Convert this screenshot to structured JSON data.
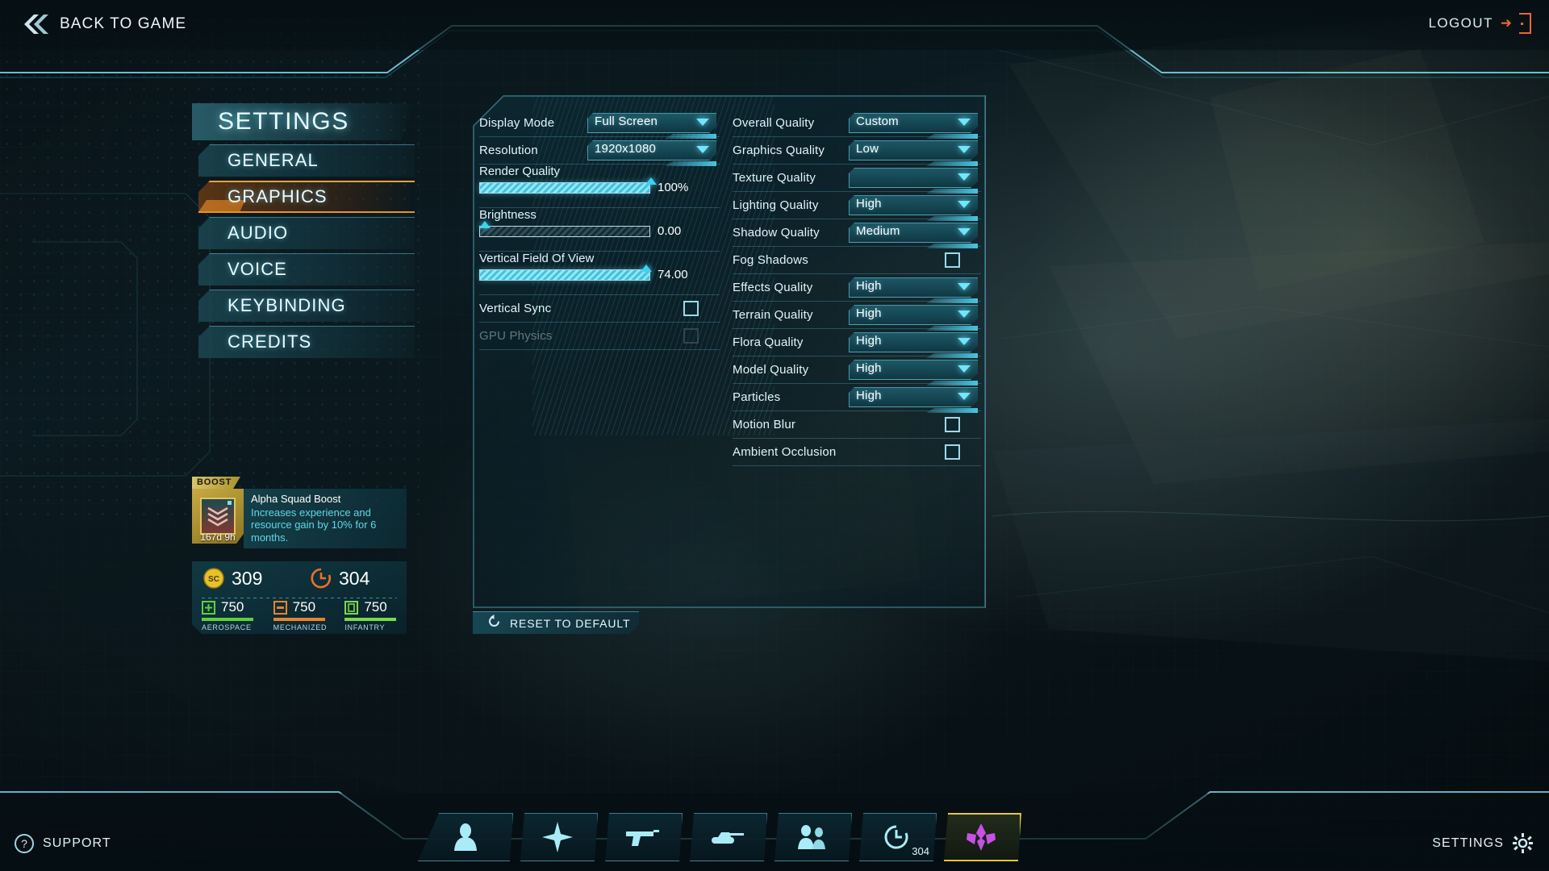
{
  "topbar": {
    "back_label": "BACK TO GAME",
    "back_icon": "double-chevron-left-icon",
    "logout_label": "LOGOUT",
    "logout_icon": "logout-door-icon"
  },
  "nav": {
    "title": "SETTINGS",
    "items": [
      {
        "label": "GENERAL",
        "active": false
      },
      {
        "label": "GRAPHICS",
        "active": true
      },
      {
        "label": "AUDIO",
        "active": false
      },
      {
        "label": "VOICE",
        "active": false
      },
      {
        "label": "KEYBINDING",
        "active": false
      },
      {
        "label": "CREDITS",
        "active": false
      }
    ]
  },
  "graphics": {
    "left_column": [
      {
        "type": "dropdown",
        "label": "Display Mode",
        "value": "Full Screen"
      },
      {
        "type": "dropdown",
        "label": "Resolution",
        "value": "1920x1080"
      },
      {
        "type": "slider",
        "label": "Render Quality",
        "value": "100%",
        "fill_pct": 100,
        "knob_pct": 100
      },
      {
        "type": "slider",
        "label": "Brightness",
        "value": "0.00",
        "fill_pct": 0,
        "knob_pct": 0
      },
      {
        "type": "slider",
        "label": "Vertical Field Of View",
        "value": "74.00",
        "fill_pct": 100,
        "knob_pct": 97
      },
      {
        "type": "checkbox",
        "label": "Vertical Sync",
        "checked": false,
        "disabled": false
      },
      {
        "type": "checkbox",
        "label": "GPU Physics",
        "checked": false,
        "disabled": true
      }
    ],
    "right_column": [
      {
        "type": "dropdown",
        "label": "Overall Quality",
        "value": "Custom"
      },
      {
        "type": "dropdown",
        "label": "Graphics Quality",
        "value": "Low"
      },
      {
        "type": "dropdown",
        "label": "Texture Quality",
        "value": ""
      },
      {
        "type": "dropdown",
        "label": "Lighting Quality",
        "value": "High"
      },
      {
        "type": "dropdown",
        "label": "Shadow Quality",
        "value": "Medium"
      },
      {
        "type": "checkbox",
        "label": "Fog Shadows",
        "checked": false,
        "disabled": false
      },
      {
        "type": "dropdown",
        "label": "Effects Quality",
        "value": "High"
      },
      {
        "type": "dropdown",
        "label": "Terrain Quality",
        "value": "High"
      },
      {
        "type": "dropdown",
        "label": "Flora Quality",
        "value": "High"
      },
      {
        "type": "dropdown",
        "label": "Model Quality",
        "value": "High"
      },
      {
        "type": "dropdown",
        "label": "Particles",
        "value": "High"
      },
      {
        "type": "checkbox",
        "label": "Motion Blur",
        "checked": false,
        "disabled": false
      },
      {
        "type": "checkbox",
        "label": "Ambient Occlusion",
        "checked": false,
        "disabled": false
      }
    ],
    "reset_label": "RESET TO DEFAULT",
    "reset_icon": "reset-circular-arrow-icon"
  },
  "boost": {
    "tag": "BOOST",
    "timer": "167d 9h",
    "title": "Alpha Squad Boost",
    "description": "Increases experience and resource gain by 10% for 6 months.",
    "icon": "boost-card-icon"
  },
  "currency": {
    "certs": {
      "icon": "station-cash-icon",
      "amount": "309"
    },
    "nanites": {
      "icon": "nanite-icon",
      "amount": "304"
    },
    "resources": [
      {
        "icon": "aerospace-icon",
        "amount": "750",
        "name": "AEROSPACE",
        "color": "#5fd13a"
      },
      {
        "icon": "mechanized-icon",
        "amount": "750",
        "name": "MECHANIZED",
        "color": "#e8852a"
      },
      {
        "icon": "infantry-icon",
        "amount": "750",
        "name": "INFANTRY",
        "color": "#7ad94a"
      }
    ]
  },
  "bottom_nav": {
    "tabs": [
      {
        "icon": "soldier-bust-icon",
        "label": "",
        "badge": "",
        "active": false
      },
      {
        "icon": "compass-star-icon",
        "label": "",
        "badge": "",
        "active": false
      },
      {
        "icon": "pistol-icon",
        "label": "",
        "badge": "",
        "active": false
      },
      {
        "icon": "tank-icon",
        "label": "",
        "badge": "",
        "active": false
      },
      {
        "icon": "squad-people-icon",
        "label": "",
        "badge": "",
        "active": false
      },
      {
        "icon": "nanite-icon",
        "label": "",
        "badge": "304",
        "active": false
      },
      {
        "icon": "vanu-sovereignty-icon",
        "label": "",
        "badge": "",
        "active": true
      }
    ]
  },
  "footer": {
    "support_label": "SUPPORT",
    "support_icon": "question-mark-icon",
    "settings_label": "SETTINGS",
    "settings_icon": "gear-icon"
  },
  "colors": {
    "accent_cyan": "#5fd8e8",
    "accent_orange": "#e8881f",
    "gold": "#e0c45a",
    "panel_bg": "#0e303a"
  }
}
